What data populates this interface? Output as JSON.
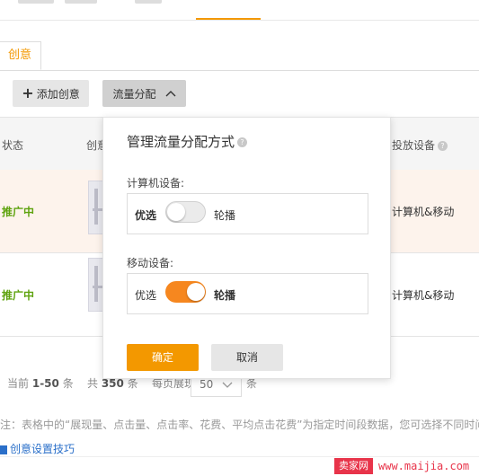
{
  "tabs": [
    {
      "label": "创意"
    }
  ],
  "toolbar": {
    "add_label": "添加创意",
    "traffic_label": "流量分配"
  },
  "table": {
    "columns": [
      "状态",
      "创意",
      "投放设备"
    ],
    "rows": [
      {
        "status": "推广中",
        "device": "计算机&移动"
      },
      {
        "status": "推广中",
        "device": "计算机&移动"
      }
    ]
  },
  "pagination": {
    "current_prefix": "当前",
    "current_range": "1-50",
    "current_unit": "条",
    "total_prefix": "共",
    "total_count": "350",
    "total_unit": "条",
    "per_page_label": "每页展现",
    "per_page_value": "50",
    "per_page_unit": "条"
  },
  "note": "注：表格中的“展现量、点击量、点击率、花费、平均点击花费”为指定时间段数据，您可选择不同时间",
  "tip_link": "创意设置技巧",
  "watermark": {
    "brand": "卖家网",
    "url": "www.maijia.com"
  },
  "popover": {
    "title": "管理流量分配方式",
    "computer_label": "计算机设备:",
    "mobile_label": "移动设备:",
    "option_left": "优选",
    "option_right": "轮播",
    "computer_toggle": "off",
    "mobile_toggle": "on",
    "confirm_label": "确定",
    "cancel_label": "取消"
  },
  "colors": {
    "accent": "#f39800",
    "status_green": "#5fa30f",
    "toggle_on": "#f6871f",
    "link": "#2a6fc9"
  }
}
